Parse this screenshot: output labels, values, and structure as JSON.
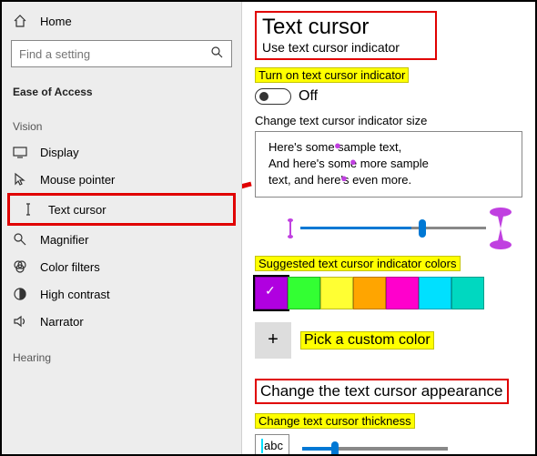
{
  "sidebar": {
    "home": "Home",
    "search_placeholder": "Find a setting",
    "category": "Ease of Access",
    "group_vision": "Vision",
    "group_hearing": "Hearing",
    "items": {
      "display": "Display",
      "mouse_pointer": "Mouse pointer",
      "text_cursor": "Text cursor",
      "magnifier": "Magnifier",
      "color_filters": "Color filters",
      "high_contrast": "High contrast",
      "narrator": "Narrator"
    }
  },
  "main": {
    "title": "Text cursor",
    "subtitle": "Use text cursor indicator",
    "toggle_label": "Turn on text cursor indicator",
    "toggle_state": "Off",
    "size_label": "Change text cursor indicator size",
    "sample_line1": "Here's some sample text,",
    "sample_line2": "And here's some more sample",
    "sample_line3": "text, and here's even more.",
    "colors_label": "Suggested text cursor indicator colors",
    "custom_label": "Pick a custom color",
    "appearance_title": "Change the text cursor appearance",
    "thickness_label": "Change text cursor thickness",
    "thickness_preview": "abc",
    "swatches": [
      "#b000e0",
      "#33ff33",
      "#ffff33",
      "#ffa500",
      "#ff00cc",
      "#00e0ff",
      "#00d8c0"
    ]
  }
}
